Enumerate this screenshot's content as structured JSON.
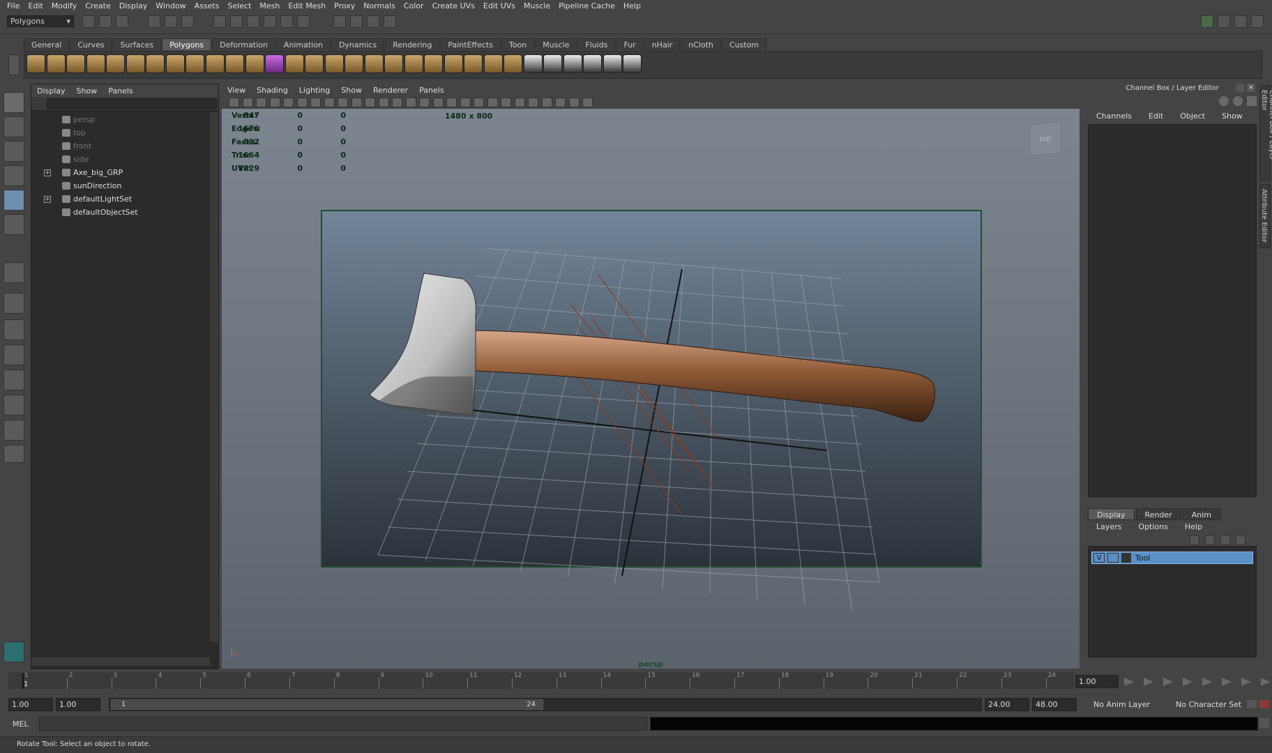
{
  "menubar": [
    "File",
    "Edit",
    "Modify",
    "Create",
    "Display",
    "Window",
    "Assets",
    "Select",
    "Mesh",
    "Edit Mesh",
    "Proxy",
    "Normals",
    "Color",
    "Create UVs",
    "Edit UVs",
    "Muscle",
    "Pipeline Cache",
    "Help"
  ],
  "mode_selector": "Polygons",
  "shelf_tabs": [
    "General",
    "Curves",
    "Surfaces",
    "Polygons",
    "Deformation",
    "Animation",
    "Dynamics",
    "Rendering",
    "PaintEffects",
    "Toon",
    "Muscle",
    "Fluids",
    "Fur",
    "nHair",
    "nCloth",
    "Custom"
  ],
  "active_shelf": "Polygons",
  "outliner": {
    "menu": [
      "Display",
      "Show",
      "Panels"
    ],
    "items": [
      {
        "label": "persp",
        "dim": true,
        "expand": false
      },
      {
        "label": "top",
        "dim": true,
        "expand": false
      },
      {
        "label": "front",
        "dim": true,
        "expand": false
      },
      {
        "label": "side",
        "dim": true,
        "expand": false
      },
      {
        "label": "Axe_big_GRP",
        "dim": false,
        "expand": true
      },
      {
        "label": "sunDirection",
        "dim": false,
        "expand": false
      },
      {
        "label": "defaultLightSet",
        "dim": false,
        "expand": true
      },
      {
        "label": "defaultObjectSet",
        "dim": false,
        "expand": false
      }
    ]
  },
  "viewport": {
    "menu": [
      "View",
      "Shading",
      "Lighting",
      "Show",
      "Renderer",
      "Panels"
    ],
    "resolution": "1480 x 800",
    "camera": "persp",
    "view_cube": "top",
    "hud": [
      {
        "label": "Verts:",
        "values": [
          "847",
          "0",
          "0"
        ]
      },
      {
        "label": "Edges:",
        "values": [
          "1676",
          "0",
          "0"
        ]
      },
      {
        "label": "Faces:",
        "values": [
          "832",
          "0",
          "0"
        ]
      },
      {
        "label": "Tris:",
        "values": [
          "1664",
          "0",
          "0"
        ]
      },
      {
        "label": "UVs:",
        "values": [
          "1029",
          "0",
          "0"
        ]
      }
    ]
  },
  "channel_box": {
    "title": "Channel Box / Layer Editor",
    "menu": [
      "Channels",
      "Edit",
      "Object",
      "Show"
    ],
    "side_tabs": [
      "Channel Box / Layer Editor",
      "Attribute Editor"
    ]
  },
  "layer_editor": {
    "tabs": [
      "Display",
      "Render",
      "Anim"
    ],
    "active_tab": "Display",
    "menu": [
      "Layers",
      "Options",
      "Help"
    ],
    "layers": [
      {
        "visible": "V",
        "name": "Tool"
      }
    ]
  },
  "timeline": {
    "ticks": [
      "1",
      "2",
      "3",
      "4",
      "5",
      "6",
      "7",
      "8",
      "9",
      "10",
      "11",
      "12",
      "13",
      "14",
      "15",
      "16",
      "17",
      "18",
      "19",
      "20",
      "21",
      "22",
      "23",
      "24"
    ],
    "current_frame": "1",
    "current_time_field": "1.00"
  },
  "range": {
    "start": "1.00",
    "playback_start": "1.00",
    "slider_start": "1",
    "slider_end": "24",
    "playback_end": "24.00",
    "end": "48.00",
    "anim_layer": "No Anim Layer",
    "character_set": "No Character Set"
  },
  "command_line": {
    "language": "MEL"
  },
  "help_line": "Rotate Tool: Select an object to rotate.",
  "colors": {
    "accent": "#5a8fc7",
    "hud_text": "#0d2a16",
    "gate_border": "#1f4f2e"
  }
}
